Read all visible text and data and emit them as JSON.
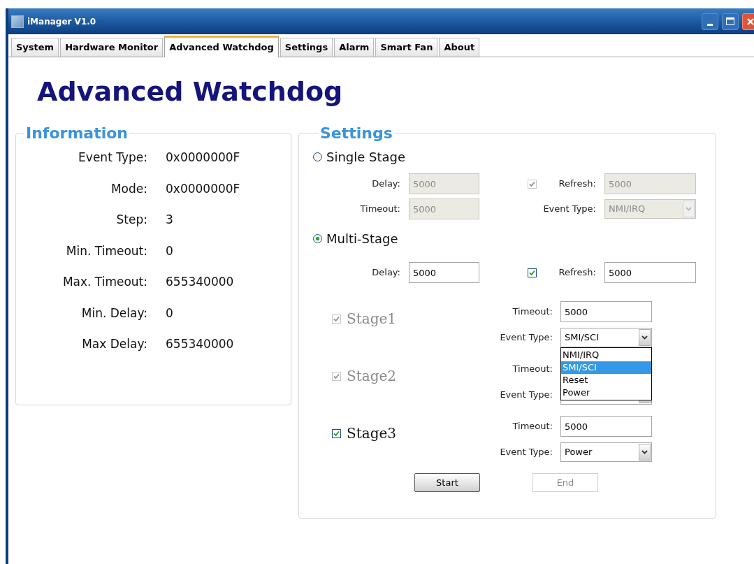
{
  "window": {
    "title": "iManager V1.0"
  },
  "tabs": [
    {
      "label": "System",
      "selected": false
    },
    {
      "label": "Hardware Monitor",
      "selected": false
    },
    {
      "label": "Advanced Watchdog",
      "selected": true
    },
    {
      "label": "Settings",
      "selected": false
    },
    {
      "label": "Alarm",
      "selected": false
    },
    {
      "label": "Smart Fan",
      "selected": false
    },
    {
      "label": "About",
      "selected": false
    }
  ],
  "heading": "Advanced Watchdog",
  "information": {
    "title": "Information",
    "rows": [
      {
        "label": "Event Type:",
        "value": "0x0000000F"
      },
      {
        "label": "Mode:",
        "value": "0x0000000F"
      },
      {
        "label": "Step:",
        "value": "3"
      },
      {
        "label": "Min. Timeout:",
        "value": "0"
      },
      {
        "label": "Max. Timeout:",
        "value": "655340000"
      },
      {
        "label": "Min. Delay:",
        "value": "0"
      },
      {
        "label": "Max Delay:",
        "value": "655340000"
      }
    ]
  },
  "settings": {
    "title": "Settings",
    "modes": [
      {
        "label": "Single Stage",
        "selected": false,
        "delay_label": "Delay:",
        "delay": "5000",
        "refresh_label": "Refresh:",
        "refresh_checked": true,
        "refresh": "5000",
        "timeout_label": "Timeout:",
        "timeout": "5000",
        "event_type_label": "Event Type:",
        "event_type": "NMI/IRQ"
      },
      {
        "label": "Multi-Stage",
        "selected": true,
        "delay_label": "Delay:",
        "delay": "5000",
        "refresh_label": "Refresh:",
        "refresh_checked": true,
        "refresh": "5000"
      }
    ],
    "stages": [
      {
        "label": "Stage1",
        "checked": true,
        "disabled": true,
        "timeout_label": "Timeout:",
        "timeout": "5000",
        "event_type_label": "Event Type:",
        "event_type": "SMI/SCI",
        "expanded": true,
        "options": [
          {
            "label": "NMI/IRQ",
            "selected": false
          },
          {
            "label": "SMI/SCI",
            "selected": true
          },
          {
            "label": "Reset",
            "selected": false
          },
          {
            "label": "Power",
            "selected": false
          }
        ]
      },
      {
        "label": "Stage2",
        "checked": true,
        "disabled": true,
        "timeout_label": "Timeout:",
        "event_type_label": "Event Type:",
        "expanded": false
      },
      {
        "label": "Stage3",
        "checked": true,
        "disabled": false,
        "timeout_label": "Timeout:",
        "timeout": "5000",
        "event_type_label": "Event Type:",
        "event_type": "Power",
        "expanded": false
      }
    ],
    "buttons": [
      {
        "label": "Start",
        "disabled": false
      },
      {
        "label": "End",
        "disabled": true
      }
    ]
  }
}
